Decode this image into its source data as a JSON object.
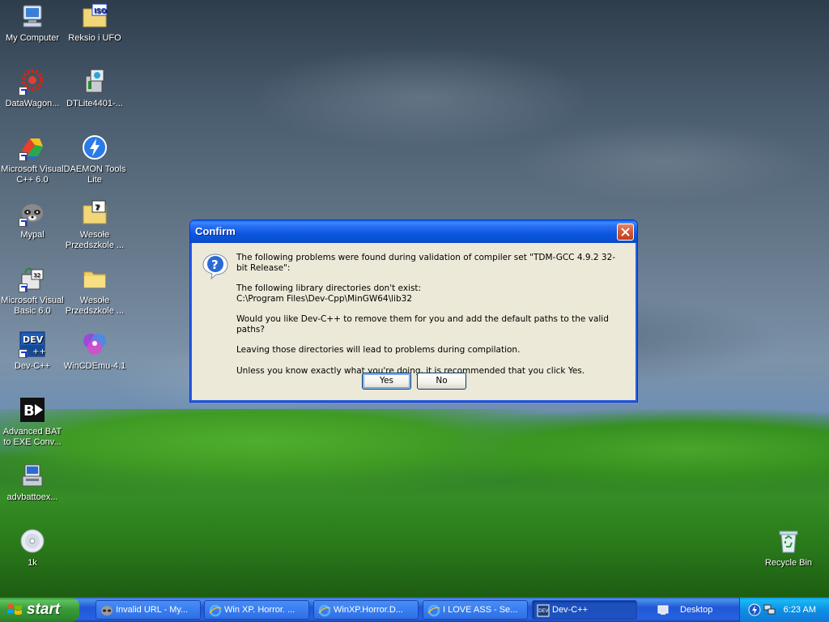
{
  "desktop": {
    "icons": [
      {
        "label": "My Computer"
      },
      {
        "label": "Reksio i UFO"
      },
      {
        "label": "DataWagon..."
      },
      {
        "label": "DTLite4401-..."
      },
      {
        "label": "Microsoft Visual C++ 6.0"
      },
      {
        "label": "DAEMON Tools Lite"
      },
      {
        "label": "Mypal"
      },
      {
        "label": "Wesołe Przedszkole ..."
      },
      {
        "label": "Microsoft Visual Basic 6.0"
      },
      {
        "label": "Wesołe Przedszkole ..."
      },
      {
        "label": "Dev-C++"
      },
      {
        "label": "WinCDEmu-4.1"
      },
      {
        "label": "Advanced BAT to EXE Conv..."
      },
      {
        "label": "advbattoex..."
      },
      {
        "label": "1k"
      },
      {
        "label": "Recycle Bin"
      }
    ],
    "icon_badges": {
      "iso": "ISO",
      "dev": "DEV"
    }
  },
  "dialog": {
    "title": "Confirm",
    "line1": "The following problems were found during validation of compiler set \"TDM-GCC 4.9.2 32-bit Release\":",
    "line2": "The following library directories don't exist:\nC:\\Program Files\\Dev-Cpp\\MinGW64\\lib32",
    "line3": "Would you like Dev-C++ to remove them for you and add the default paths to the valid paths?",
    "line4": "Leaving those directories will lead to problems during compilation.",
    "line5": "Unless you know exactly what you're doing, it is recommended that you click Yes.",
    "yes_label": "Yes",
    "no_label": "No"
  },
  "taskbar": {
    "start_label": "start",
    "tasks": [
      {
        "label": "Invalid URL - My..."
      },
      {
        "label": "Win XP. Horror. ..."
      },
      {
        "label": "WinXP.Horror.D..."
      },
      {
        "label": "I LOVE ASS - Se..."
      },
      {
        "label": "Dev-C++"
      }
    ],
    "desktop_toolbar_label": "Desktop",
    "clock": "6:23 AM"
  },
  "colors": {
    "titlebar": "#0b57e0",
    "dialog_bg": "#ece9d8",
    "taskbar": "#2157d7",
    "start_button": "#3b9b3b",
    "tray": "#0f8fe3"
  }
}
